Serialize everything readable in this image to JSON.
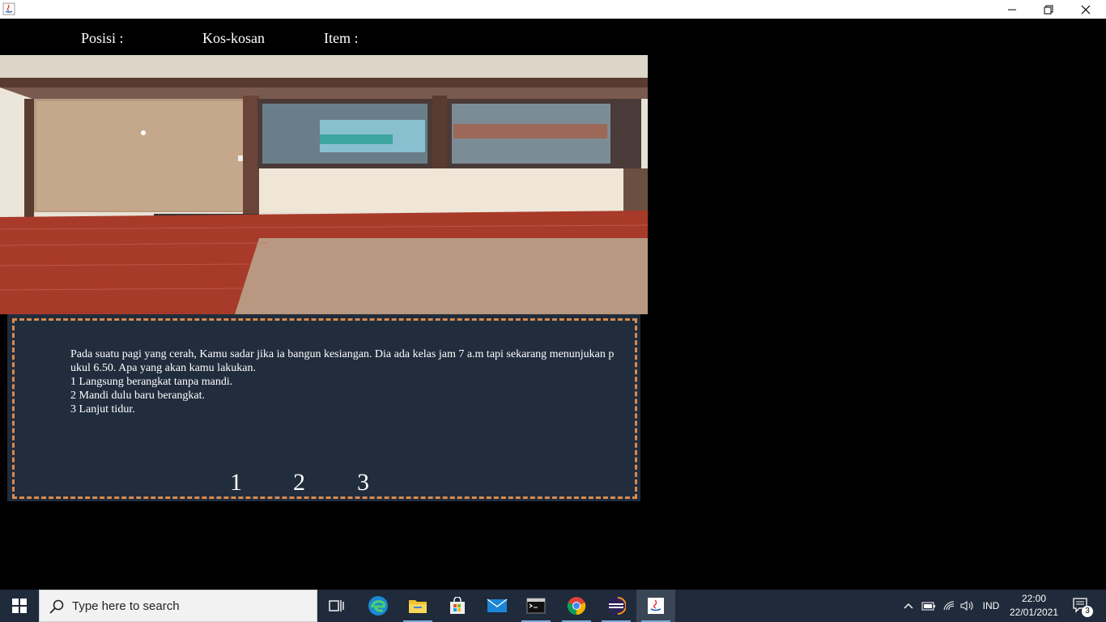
{
  "window": {
    "icons": {
      "app": "java-icon",
      "minimize": "minimize-icon",
      "maximize": "restore-icon",
      "close": "close-icon"
    }
  },
  "hud": {
    "position_label": "Posisi :",
    "position_value": "Kos-kosan",
    "item_label": "Item :"
  },
  "dialog": {
    "lines": [
      "Pada suatu pagi yang cerah, Kamu sadar jika ia bangun kesiangan. Dia ada kelas jam 7 a.m tapi sekarang menunjukan p",
      "ukul 6.50. Apa yang akan kamu lakukan.",
      "1 Langsung berangkat tanpa mandi.",
      "2 Mandi dulu baru berangkat.",
      "3 Lanjut tidur."
    ],
    "choices": [
      "1",
      "2",
      "3"
    ],
    "border_color": "#d98a4e",
    "bg_color": "#212d3d"
  },
  "taskbar": {
    "search_placeholder": "Type here to search",
    "pinned": [
      "task-view-icon",
      "edge-icon",
      "file-explorer-icon",
      "store-icon",
      "mail-icon",
      "terminal-icon",
      "chrome-icon",
      "eclipse-icon",
      "java-icon"
    ],
    "language": "IND",
    "time": "22:00",
    "date": "22/01/2021",
    "notification_count": "3"
  }
}
